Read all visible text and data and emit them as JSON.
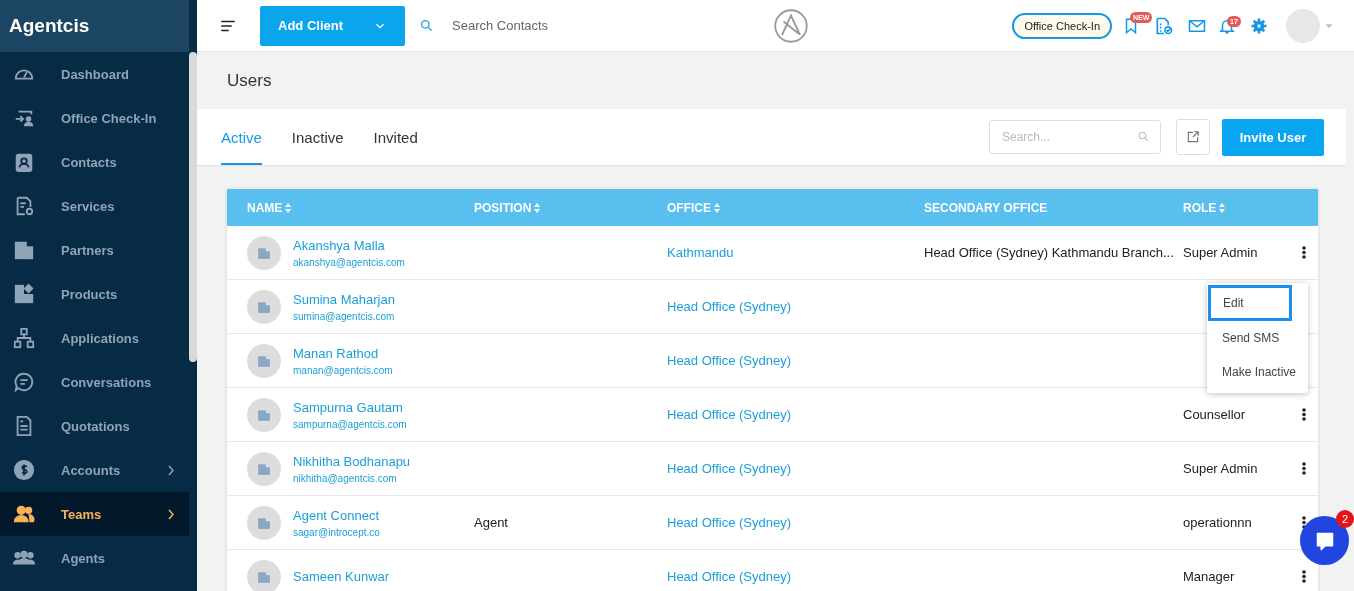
{
  "sidebar": {
    "brand": "Agentcis",
    "items": [
      {
        "label": "Dashboard",
        "selected": false,
        "arrow": false
      },
      {
        "label": "Office Check-In",
        "selected": false,
        "arrow": false
      },
      {
        "label": "Contacts",
        "selected": false,
        "arrow": false
      },
      {
        "label": "Services",
        "selected": false,
        "arrow": false
      },
      {
        "label": "Partners",
        "selected": false,
        "arrow": false
      },
      {
        "label": "Products",
        "selected": false,
        "arrow": false
      },
      {
        "label": "Applications",
        "selected": false,
        "arrow": false
      },
      {
        "label": "Conversations",
        "selected": false,
        "arrow": false
      },
      {
        "label": "Quotations",
        "selected": false,
        "arrow": false
      },
      {
        "label": "Accounts",
        "selected": false,
        "arrow": true
      },
      {
        "label": "Teams",
        "selected": true,
        "arrow": true
      },
      {
        "label": "Agents",
        "selected": false,
        "arrow": false
      }
    ]
  },
  "topbar": {
    "add_button": "Add Client",
    "search": {
      "placeholder": "Search Contacts"
    },
    "checkin_button": "Office Check-In",
    "bookmark_badge": "NEW",
    "notification_badge": "17"
  },
  "page": {
    "title": "Users",
    "tabs": [
      {
        "label": "Active",
        "selected": true
      },
      {
        "label": "Inactive",
        "selected": false
      },
      {
        "label": "Invited",
        "selected": false
      }
    ],
    "search": {
      "placeholder": "Search..."
    },
    "invite_button": "Invite User"
  },
  "table": {
    "columns": [
      {
        "label": "NAME",
        "sortable": true
      },
      {
        "label": "POSITION",
        "sortable": true
      },
      {
        "label": "OFFICE",
        "sortable": true
      },
      {
        "label": "SECONDARY OFFICE",
        "sortable": false
      },
      {
        "label": "ROLE",
        "sortable": true
      }
    ],
    "rows": [
      {
        "name": "Akanshya Malla",
        "email": "akanshya@agentcis.com",
        "office": "Kathmandu",
        "secondary_office": "Head Office (Sydney) Kathmandu Branch...",
        "role": "Super Admin",
        "menu_button": true
      },
      {
        "name": "Sumina Maharjan",
        "email": "sumina@agentcis.com",
        "office": "Head Office (Sydney)",
        "menu_button": false
      },
      {
        "name": "Manan Rathod",
        "email": "manan@agentcis.com",
        "office": "Head Office (Sydney)",
        "menu_button": false
      },
      {
        "name": "Sampurna Gautam",
        "email": "sampurna@agentcis.com",
        "office": "Head Office (Sydney)",
        "role": "Counsellor",
        "menu_button": true
      },
      {
        "name": "Nikhitha Bodhanapu",
        "email": "nikhitha@agentcis.com",
        "office": "Head Office (Sydney)",
        "role": "Super Admin",
        "menu_button": true
      },
      {
        "name": "Agent Connect",
        "email": "sagar@introcept.co",
        "position": "Agent",
        "office": "Head Office (Sydney)",
        "role": "operationnn",
        "menu_button": true
      },
      {
        "name": "Sameen Kunwar",
        "office": "Head Office (Sydney)",
        "role": "Manager",
        "menu_button": true
      }
    ]
  },
  "row_menu": {
    "items": [
      {
        "label": "Edit",
        "selected": true
      },
      {
        "label": "Send SMS",
        "selected": false
      },
      {
        "label": "Make Inactive",
        "selected": false
      }
    ]
  },
  "chat": {
    "badge": "2"
  }
}
